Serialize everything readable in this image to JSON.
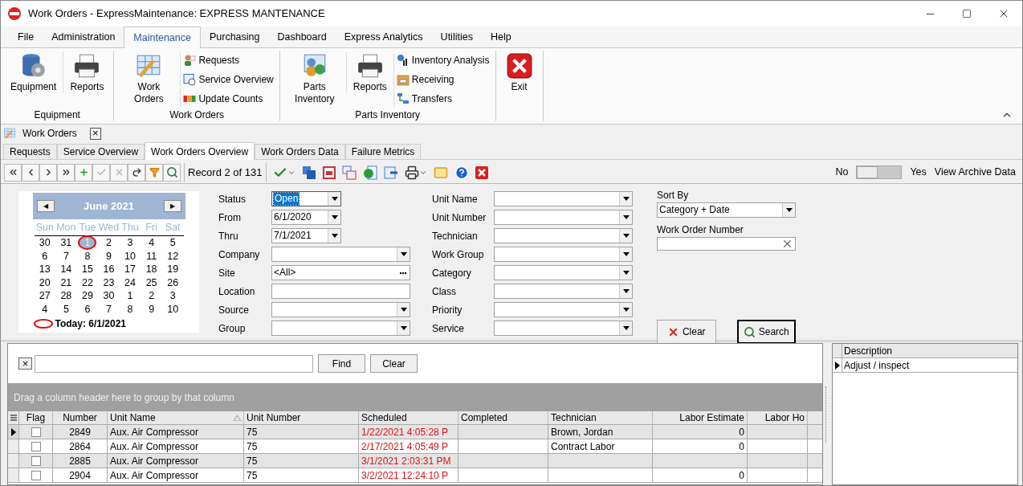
{
  "window": {
    "title": "Work Orders - ExpressMaintenance: EXPRESS MANTENANCE"
  },
  "menu": [
    {
      "label": "File",
      "selected": false
    },
    {
      "label": "Administration",
      "selected": false
    },
    {
      "label": "Maintenance",
      "selected": true
    },
    {
      "label": "Purchasing",
      "selected": false
    },
    {
      "label": "Dashboard",
      "selected": false
    },
    {
      "label": "Express Analytics",
      "selected": false
    },
    {
      "label": "Utilities",
      "selected": false
    },
    {
      "label": "Help",
      "selected": false
    }
  ],
  "ribbon": [
    {
      "label": "Equipment",
      "items": [
        {
          "kind": "large",
          "label": "Equipment"
        },
        {
          "kind": "large",
          "label": "Reports"
        }
      ]
    },
    {
      "label": "Work Orders",
      "items": [
        {
          "kind": "large",
          "label": "Work Orders"
        },
        {
          "kind": "small",
          "label": "Requests"
        },
        {
          "kind": "small",
          "label": "Service Overview"
        },
        {
          "kind": "small",
          "label": "Update Counts"
        }
      ]
    },
    {
      "label": "Parts Inventory",
      "items": [
        {
          "kind": "large",
          "label": "Parts Inventory"
        },
        {
          "kind": "large",
          "label": "Reports"
        },
        {
          "kind": "small",
          "label": "Inventory Analysis"
        },
        {
          "kind": "small",
          "label": "Receiving"
        },
        {
          "kind": "small",
          "label": "Transfers"
        }
      ]
    },
    {
      "items": [
        {
          "kind": "large",
          "label": "Exit"
        }
      ]
    }
  ],
  "document_tab": {
    "label": "Work Orders",
    "close": "×"
  },
  "tabs": [
    {
      "label": "Requests",
      "selected": false
    },
    {
      "label": "Service Overview",
      "selected": false
    },
    {
      "label": "Work Orders Overview",
      "selected": true
    },
    {
      "label": "Work Orders Data",
      "selected": false
    },
    {
      "label": "Failure Metrics",
      "selected": false
    }
  ],
  "toolbar": {
    "buttons": [
      {
        "kind": "first",
        "disabled": false
      },
      {
        "kind": "prev",
        "disabled": false
      },
      {
        "kind": "next",
        "disabled": false
      },
      {
        "kind": "last",
        "disabled": false
      },
      {
        "kind": "add",
        "disabled": false
      },
      {
        "kind": "save",
        "disabled": true
      },
      {
        "kind": "cancel",
        "disabled": true
      },
      {
        "kind": "refresh",
        "disabled": false
      },
      {
        "kind": "filter",
        "disabled": false
      },
      {
        "kind": "find",
        "disabled": false
      }
    ],
    "record": "Record 2 of 131",
    "actions": [
      {
        "kind": "approve"
      },
      {
        "kind": "copy"
      },
      {
        "kind": "form"
      },
      {
        "kind": "windows"
      },
      {
        "kind": "money"
      },
      {
        "kind": "export"
      },
      {
        "kind": "print"
      },
      {
        "kind": "mail"
      },
      {
        "kind": "help"
      },
      {
        "kind": "close"
      }
    ],
    "archive": {
      "off_label": "No",
      "on_label": "Yes",
      "label": "View Archive Data",
      "on": false
    }
  },
  "calendar": {
    "month": "June 2021",
    "prev": "◀",
    "next": "▶",
    "weekdays": [
      "Sun",
      "Mon",
      "Tue",
      "Wed",
      "Thu",
      "Fri",
      "Sat"
    ],
    "weeks": [
      [
        {
          "label": "30",
          "selected": false
        },
        {
          "label": "31",
          "selected": false
        },
        {
          "label": "1",
          "selected": true
        },
        {
          "label": "2",
          "selected": false
        },
        {
          "label": "3",
          "selected": false
        },
        {
          "label": "4",
          "selected": false
        },
        {
          "label": "5",
          "selected": false
        }
      ],
      [
        {
          "label": "6",
          "selected": false
        },
        {
          "label": "7",
          "selected": false
        },
        {
          "label": "8",
          "selected": false
        },
        {
          "label": "9",
          "selected": false
        },
        {
          "label": "10",
          "selected": false
        },
        {
          "label": "11",
          "selected": false
        },
        {
          "label": "12",
          "selected": false
        }
      ],
      [
        {
          "label": "13",
          "selected": false
        },
        {
          "label": "14",
          "selected": false
        },
        {
          "label": "15",
          "selected": false
        },
        {
          "label": "16",
          "selected": false
        },
        {
          "label": "17",
          "selected": false
        },
        {
          "label": "18",
          "selected": false
        },
        {
          "label": "19",
          "selected": false
        }
      ],
      [
        {
          "label": "20",
          "selected": false
        },
        {
          "label": "21",
          "selected": false
        },
        {
          "label": "22",
          "selected": false
        },
        {
          "label": "23",
          "selected": false
        },
        {
          "label": "24",
          "selected": false
        },
        {
          "label": "25",
          "selected": false
        },
        {
          "label": "26",
          "selected": false
        }
      ],
      [
        {
          "label": "27",
          "selected": false
        },
        {
          "label": "28",
          "selected": false
        },
        {
          "label": "29",
          "selected": false
        },
        {
          "label": "30",
          "selected": false
        },
        {
          "label": "1",
          "selected": false
        },
        {
          "label": "2",
          "selected": false
        },
        {
          "label": "3",
          "selected": false
        }
      ],
      [
        {
          "label": "4",
          "selected": false
        },
        {
          "label": "5",
          "selected": false
        },
        {
          "label": "6",
          "selected": false
        },
        {
          "label": "7",
          "selected": false
        },
        {
          "label": "8",
          "selected": false
        },
        {
          "label": "9",
          "selected": false
        },
        {
          "label": "10",
          "selected": false
        }
      ]
    ],
    "today": "Today: 6/1/2021"
  },
  "filters_left": [
    {
      "label": "Status",
      "value": "Open",
      "kind": "short",
      "focused": true
    },
    {
      "label": "From",
      "value": "6/1/2020",
      "kind": "short",
      "focused": false
    },
    {
      "label": "Thru",
      "value": "7/1/2021",
      "kind": "short",
      "focused": false
    },
    {
      "label": "Company",
      "kind": "dropdown",
      "focused": false
    },
    {
      "label": "Site",
      "value": "<All>",
      "kind": "ellipsis",
      "focused": false
    },
    {
      "label": "Location",
      "kind": "text",
      "focused": false
    },
    {
      "label": "Source",
      "kind": "dropdown",
      "focused": false
    },
    {
      "label": "Group",
      "kind": "dropdown",
      "focused": false
    }
  ],
  "filters_right": [
    {
      "label": "Unit Name"
    },
    {
      "label": "Unit Number"
    },
    {
      "label": "Technician"
    },
    {
      "label": "Work Group"
    },
    {
      "label": "Category"
    },
    {
      "label": "Class"
    },
    {
      "label": "Priority"
    },
    {
      "label": "Service"
    }
  ],
  "sort_by": {
    "label": "Sort By",
    "value": "Category + Date"
  },
  "work_order_number": {
    "label": "Work Order Number"
  },
  "actions": [
    {
      "label": "Clear",
      "kind": "clear",
      "default": false
    },
    {
      "label": "Search",
      "kind": "search",
      "default": true
    }
  ],
  "find_bar": {
    "close": "×",
    "buttons": [
      "Find",
      "Clear"
    ]
  },
  "group_panel": "Drag a column header here to group by that column",
  "grid": {
    "columns": [
      {
        "label": "Flag",
        "sorted": false
      },
      {
        "label": "Number",
        "sorted": false
      },
      {
        "label": "Unit Name",
        "sorted": true
      },
      {
        "label": "Unit Number",
        "sorted": false
      },
      {
        "label": "Scheduled",
        "sorted": false
      },
      {
        "label": "Completed",
        "sorted": false
      },
      {
        "label": "Technician",
        "sorted": false
      },
      {
        "label": "Labor Estimate",
        "sorted": false
      },
      {
        "label": "Labor Ho",
        "sorted": false
      }
    ],
    "rows": [
      {
        "current": true,
        "flag": false,
        "overdue": true,
        "cells": [
          "",
          "2849",
          "Aux. Air Compressor",
          "75",
          "1/22/2021 4:05:28 P",
          "",
          "Brown, Jordan",
          "0",
          ""
        ]
      },
      {
        "current": false,
        "flag": false,
        "overdue": true,
        "cells": [
          "",
          "2864",
          "Aux. Air Compressor",
          "75",
          "2/17/2021 4:05:49 P",
          "",
          "Contract Labor",
          "0",
          ""
        ]
      },
      {
        "current": false,
        "flag": false,
        "overdue": true,
        "cells": [
          "",
          "2885",
          "Aux. Air Compressor",
          "75",
          "3/1/2021 2:03:31 PM",
          "",
          "",
          "",
          ""
        ]
      },
      {
        "current": false,
        "flag": false,
        "overdue": true,
        "cells": [
          "",
          "2904",
          "Aux. Air Compressor",
          "75",
          "3/2/2021 12:24:10 P",
          "",
          "",
          "0",
          ""
        ]
      }
    ]
  },
  "description_panel": {
    "column": "Description",
    "rows": [
      {
        "text": "Adjust / inspect",
        "current": true
      }
    ]
  }
}
